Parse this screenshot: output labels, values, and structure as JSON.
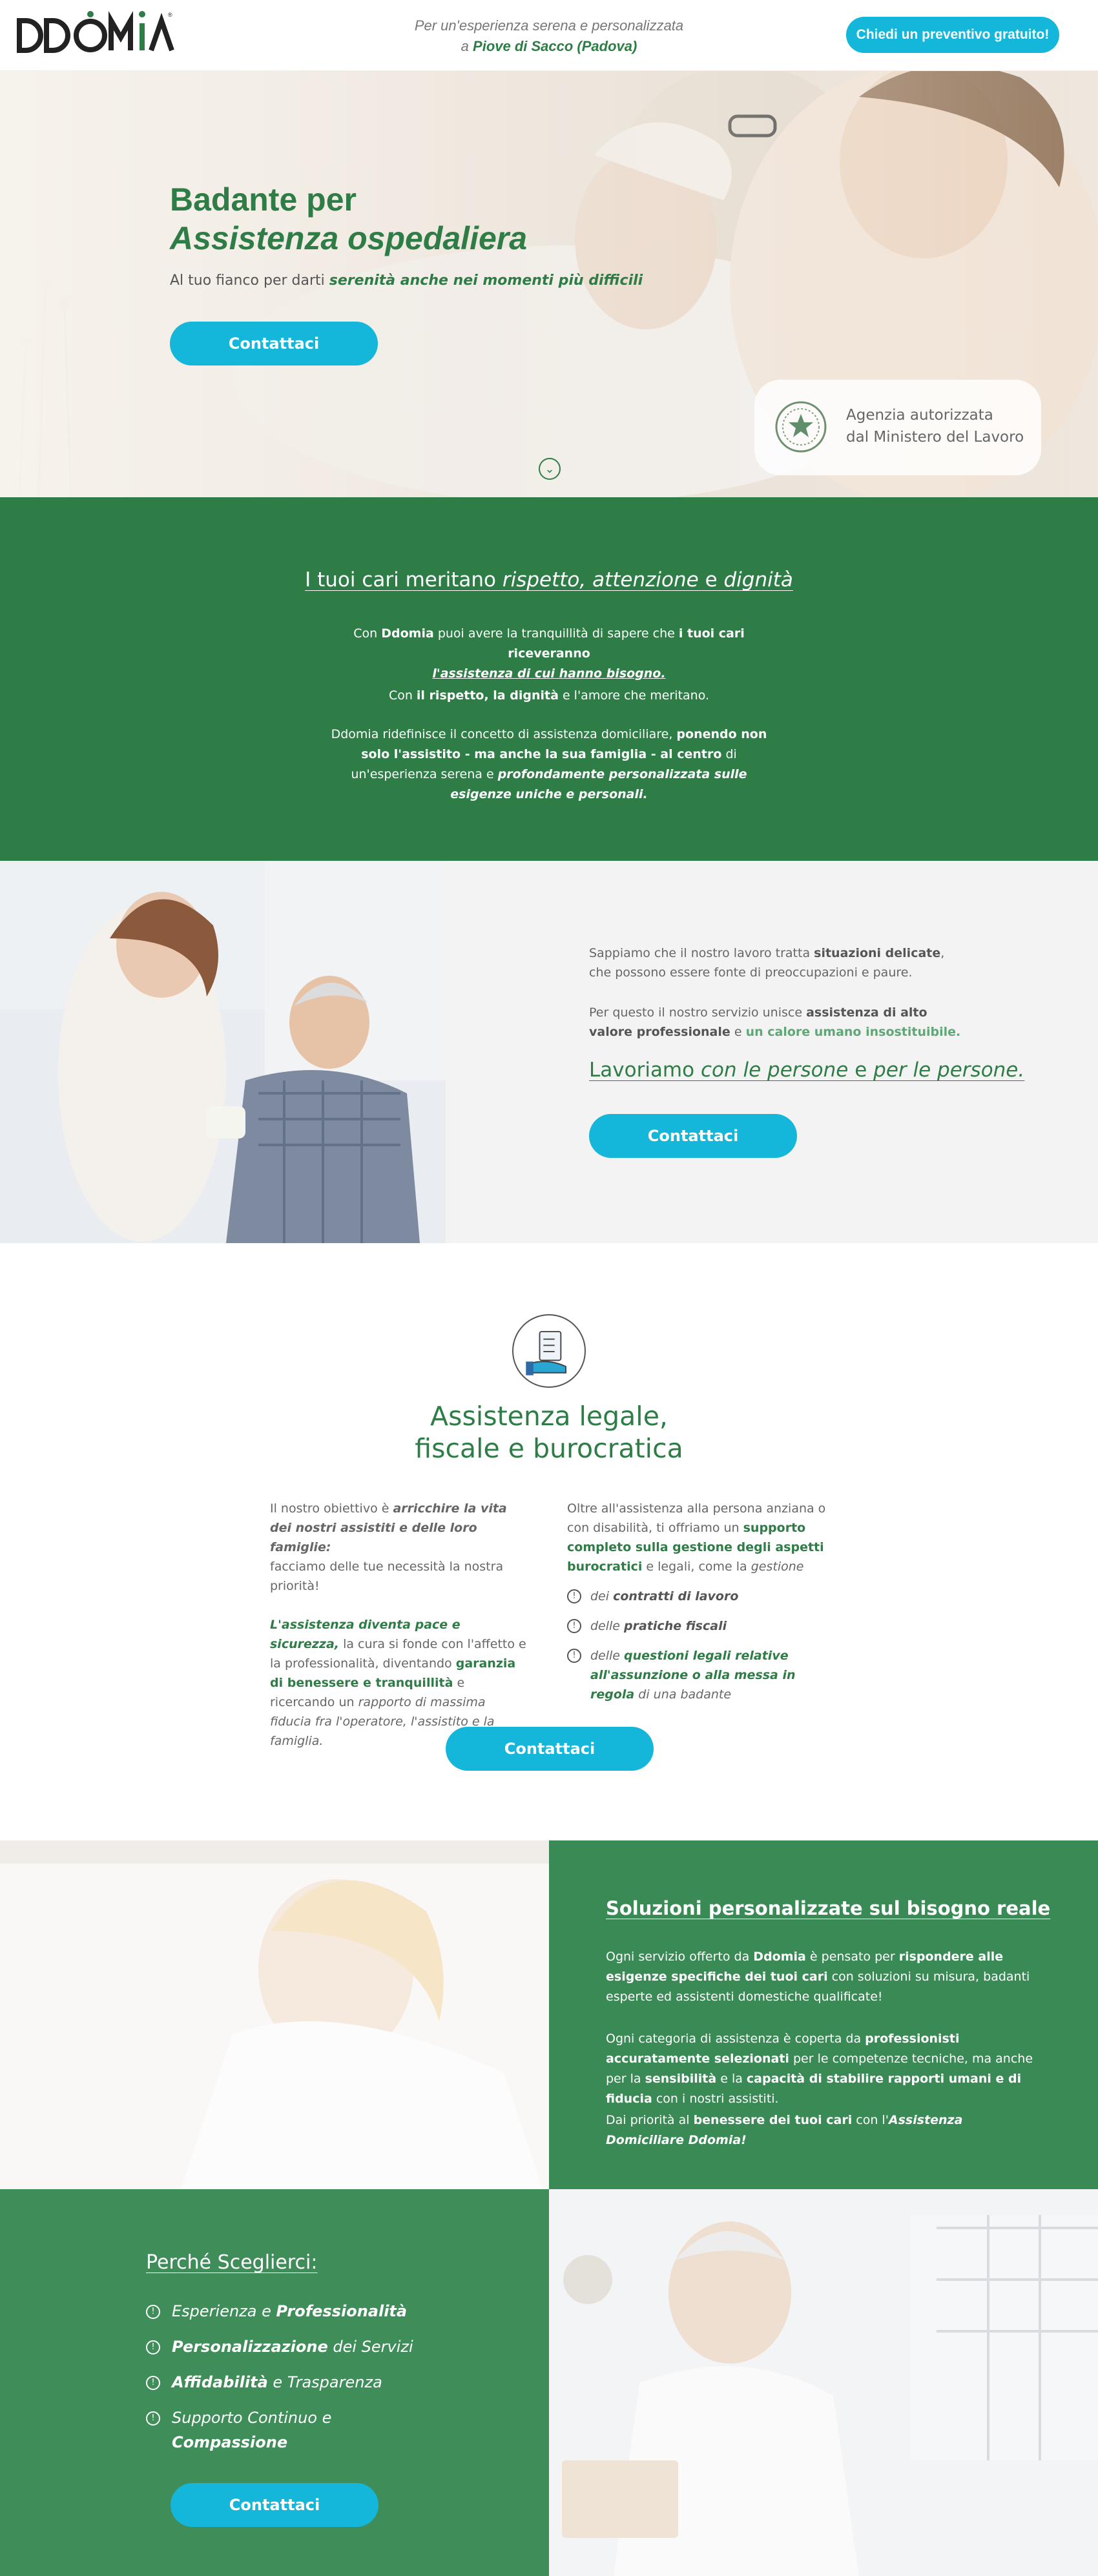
{
  "header": {
    "logo_text": "DDOMIA",
    "tagline_line1": "Per un'esperienza serena e personalizzata",
    "tagline_prefix": "a",
    "tagline_location": "Piove di Sacco (Padova)",
    "cta": "Chiedi un preventivo gratuito!"
  },
  "hero": {
    "title_line1": "Badante per",
    "title_line2": "Assistenza ospedaliera",
    "subtitle_prefix": "Al tuo fianco per darti",
    "subtitle_emphasis": "serenità anche nei momenti più difficili",
    "button": "Contattaci",
    "badge_line1": "Agenzia autorizzata",
    "badge_line2": "dal Ministero del Lavoro"
  },
  "intro": {
    "title_prefix": "I tuoi cari meritano",
    "title_em1": "rispetto, attenzione",
    "title_mid": "e",
    "title_em2": "dignità",
    "p1_a": "Con",
    "p1_b": "Ddomia",
    "p1_c": "puoi avere la tranquillità di sapere che",
    "p1_d": "i tuoi cari riceveranno",
    "p1_e": "l'assistenza di cui hanno bisogno.",
    "p2_a": "Con",
    "p2_b": "il rispetto, la dignità",
    "p2_c": "e l'amore che meritano.",
    "p3_a": "Ddomia ridefinisce il concetto di assistenza domiciliare,",
    "p3_b": "ponendo non solo l'assistito - ma anche la sua famiglia - al centro",
    "p3_c": "di un'esperienza serena e",
    "p3_d": "profondamente personalizzata sulle esigenze uniche e personali."
  },
  "section3": {
    "p1_a": "Sappiamo che il nostro lavoro tratta",
    "p1_b": "situazioni delicate",
    "p1_c": ", che possono essere fonte di preoccupazioni e paure.",
    "p2_a": "Per questo il nostro servizio unisce",
    "p2_b": "assistenza di alto valore professionale",
    "p2_c": "e",
    "p2_d": "un calore umano insostituibile.",
    "head_a": "Lavoriamo",
    "head_b": "con le persone",
    "head_c": "e",
    "head_d": "per le persone.",
    "button": "Contattaci"
  },
  "legal": {
    "title_line1": "Assistenza legale,",
    "title_line2": "fiscale e burocratica",
    "c1_a": "Il nostro obiettivo è",
    "c1_b": "arricchire la vita dei nostri assistiti e delle loro famiglie:",
    "c1_c": "facciamo delle tue necessità la nostra priorità!",
    "c1_d": "L'assistenza diventa pace e sicurezza,",
    "c1_e": "la cura si fonde con l'affetto e la professionalità, diventando",
    "c1_f": "garanzia di benessere e tranquillità",
    "c1_g": "e ricercando un",
    "c1_h": "rapporto di massima fiducia fra l'operatore, l'assistito e la famiglia.",
    "c2_a": "Oltre all'assistenza alla persona anziana o con disabilità, ti offriamo un",
    "c2_b": "supporto completo sulla gestione degli aspetti burocratici",
    "c2_c": "e legali, come la",
    "c2_d": "gestione",
    "items": [
      {
        "pre": "dei",
        "bold": "contratti di lavoro",
        "post": ""
      },
      {
        "pre": "delle",
        "bold": "pratiche fiscali",
        "post": ""
      },
      {
        "pre": "delle",
        "bold": "questioni legali relative all'assunzione o alla messa in regola",
        "post": "di una badante"
      }
    ],
    "button": "Contattaci"
  },
  "section5": {
    "title": "Soluzioni personalizzate sul bisogno reale",
    "p1_a": "Ogni servizio offerto da",
    "p1_b": "Ddomia",
    "p1_c": "è pensato per",
    "p1_d": "rispondere alle esigenze specifiche dei tuoi cari",
    "p1_e": "con soluzioni su misura, badanti esperte ed assistenti domestiche qualificate!",
    "p2_a": "Ogni categoria di assistenza è coperta da",
    "p2_b": "professionisti accuratamente selezionati",
    "p2_c": "per le competenze tecniche, ma anche per la",
    "p2_d": "sensibilità",
    "p2_e": "e la",
    "p2_f": "capacità di stabilire rapporti umani e di fiducia",
    "p2_g": "con i nostri assistiti.",
    "p3_a": "Dai priorità al",
    "p3_b": "benessere dei tuoi cari",
    "p3_c": "con l'",
    "p3_d": "Assistenza Domiciliare Ddomia!"
  },
  "section6": {
    "title": "Perché Sceglierci:",
    "items": [
      {
        "a": "Esperienza",
        "b": " e ",
        "c": "Professionalità"
      },
      {
        "a": "Personalizzazione",
        "b": " dei Servizi",
        "c": ""
      },
      {
        "a": "Affidabilità",
        "b": " e Trasparenza",
        "c": ""
      },
      {
        "a": "Supporto Continuo",
        "b": " e ",
        "c": "Compassione"
      }
    ],
    "button": "Contattaci"
  },
  "colors": {
    "brand_green": "#2e7d46",
    "accent_cyan": "#14b6d9"
  },
  "icons": [
    "scroll-down-icon",
    "italian-emblem-icon",
    "legal-checklist-icon",
    "list-bullet-icon"
  ]
}
